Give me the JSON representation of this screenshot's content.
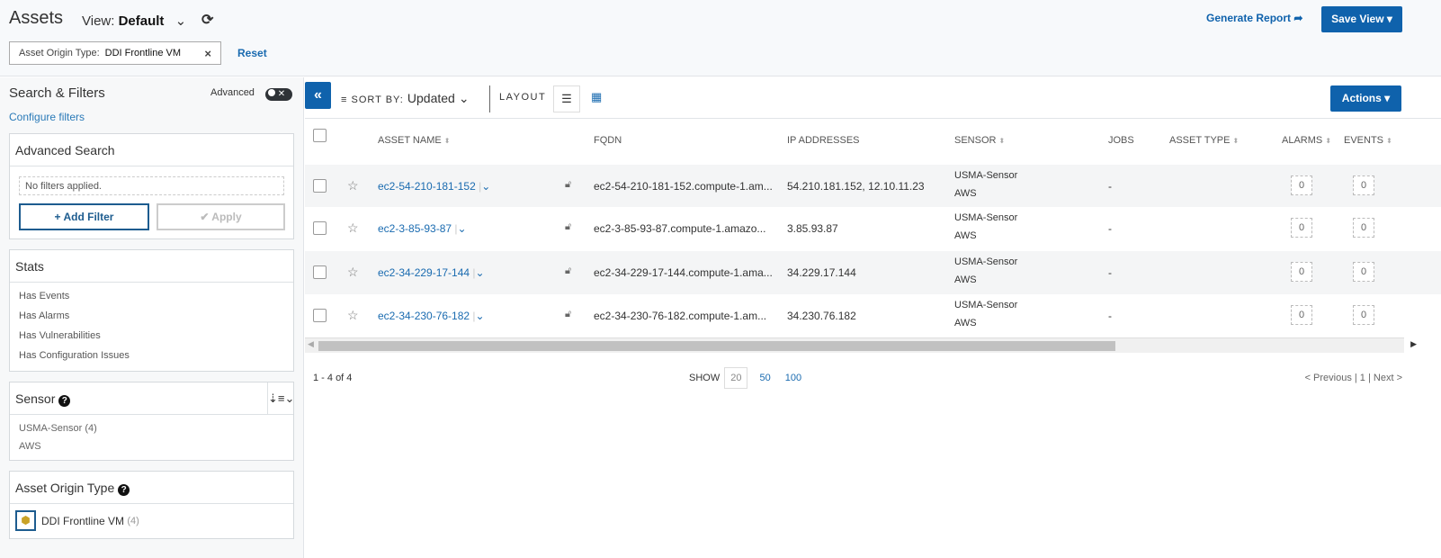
{
  "header": {
    "title": "Assets",
    "view_label": "View:",
    "view_value": "Default",
    "filter_chip_label": "Asset Origin Type:",
    "filter_chip_value": "DDI Frontline VM",
    "reset": "Reset",
    "generate_report": "Generate Report",
    "save_view": "Save View"
  },
  "sidebar": {
    "title": "Search & Filters",
    "advanced": "Advanced",
    "configure": "Configure filters",
    "advanced_search": {
      "title": "Advanced Search",
      "placeholder": "No filters applied.",
      "add_filter": "Add Filter",
      "apply": "Apply"
    },
    "stats": {
      "title": "Stats",
      "items": [
        "Has Events",
        "Has Alarms",
        "Has Vulnerabilities",
        "Has Configuration Issues"
      ]
    },
    "sensor": {
      "title": "Sensor",
      "items": [
        "USMA-Sensor (4)",
        "AWS"
      ]
    },
    "origin": {
      "title": "Asset Origin Type",
      "item": "DDI Frontline VM",
      "count": "(4)"
    }
  },
  "toolbar": {
    "sort_label": "SORT BY:",
    "sort_value": "Updated",
    "layout": "LAYOUT",
    "actions": "Actions"
  },
  "table": {
    "headers": [
      "ASSET NAME",
      "FQDN",
      "IP ADDRESSES",
      "SENSOR",
      "JOBS",
      "ASSET TYPE",
      "ALARMS",
      "EVENTS"
    ],
    "rows": [
      {
        "name": "ec2-54-210-181-152",
        "fqdn": "ec2-54-210-181-152.compute-1.am...",
        "ip": "54.210.181.152, 12.10.11.23",
        "sensor": "USMA-Sensor",
        "sensor2": "AWS",
        "jobs": "-",
        "alarms": "0",
        "events": "0"
      },
      {
        "name": "ec2-3-85-93-87",
        "fqdn": "ec2-3-85-93-87.compute-1.amazo...",
        "ip": "3.85.93.87",
        "sensor": "USMA-Sensor",
        "sensor2": "AWS",
        "jobs": "-",
        "alarms": "0",
        "events": "0"
      },
      {
        "name": "ec2-34-229-17-144",
        "fqdn": "ec2-34-229-17-144.compute-1.ama...",
        "ip": "34.229.17.144",
        "sensor": "USMA-Sensor",
        "sensor2": "AWS",
        "jobs": "-",
        "alarms": "0",
        "events": "0"
      },
      {
        "name": "ec2-34-230-76-182",
        "fqdn": "ec2-34-230-76-182.compute-1.am...",
        "ip": "34.230.76.182",
        "sensor": "USMA-Sensor",
        "sensor2": "AWS",
        "jobs": "-",
        "alarms": "0",
        "events": "0"
      }
    ]
  },
  "footer": {
    "range": "1 - 4 of 4",
    "show": "SHOW",
    "sizes": [
      "20",
      "50",
      "100"
    ],
    "pager": "< Previous | 1 | Next >"
  }
}
